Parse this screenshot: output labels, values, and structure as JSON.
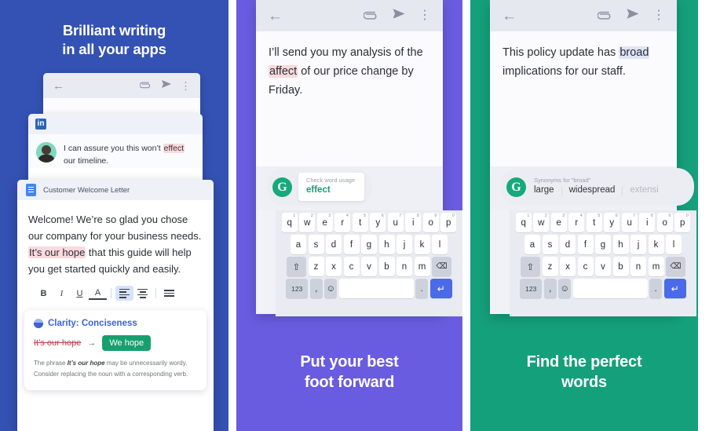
{
  "panels": [
    {
      "id": "panel-brilliant-writing",
      "bg": "#3452b4",
      "headline": "Brilliant writing\nin all your apps",
      "headline_line1": "Brilliant writing",
      "headline_line2": "in all your apps",
      "email_card": {
        "icons": [
          "back-arrow-icon",
          "attachment-icon",
          "send-icon",
          "overflow-menu-icon"
        ]
      },
      "linkedin_card": {
        "logo_text": "in",
        "message_line1_pre": "I can assure you this won’t",
        "message_highlight": "effect",
        "message_line2_post": " our timeline."
      },
      "doc_card": {
        "title": "Customer Welcome Letter",
        "paragraph_pre": "Welcome! We’re so glad you chose our company for your business needs. ",
        "paragraph_highlight": "It’s our hope",
        "paragraph_post": " that this guide will help you get started quickly and easily.",
        "toolbar": [
          "B",
          "I",
          "U",
          "A"
        ],
        "clarity_card": {
          "title": "Clarity: Conciseness",
          "old_text": "It’s our hope",
          "arrow": "→",
          "new_text": "We hope",
          "desc_pre": "The phrase ",
          "desc_bold": "It’s our hope",
          "desc_post": " may be unnecessarily wordy. Consider replacing the noun with a corresponding verb."
        }
      }
    },
    {
      "id": "panel-put-your-best-foot-forward",
      "bg": "#6a5ce0",
      "caption_line1": "Put your best",
      "caption_line2": "foot forward",
      "message_pre": "I’ll send you my analysis of the ",
      "message_highlight": "affect",
      "message_post": " of our price change by Friday.",
      "chip": {
        "logo": "G",
        "label": "Check word usage",
        "value": "effect"
      }
    },
    {
      "id": "panel-find-the-perfect-words",
      "bg": "#14a07a",
      "caption_line1": "Find the perfect",
      "caption_line2": "words",
      "message_pre": "This policy update has ",
      "message_highlight": "broad",
      "message_post": " implications for our staff.",
      "chip": {
        "logo": "G",
        "label": "Synonyms for “broad”",
        "synonyms": [
          "large",
          "widespread",
          "extensi"
        ]
      }
    }
  ],
  "keyboard": {
    "row1": [
      {
        "k": "q",
        "n": "1"
      },
      {
        "k": "w",
        "n": "2"
      },
      {
        "k": "e",
        "n": "3"
      },
      {
        "k": "r",
        "n": "4"
      },
      {
        "k": "t",
        "n": "5"
      },
      {
        "k": "y",
        "n": "6"
      },
      {
        "k": "u",
        "n": "7"
      },
      {
        "k": "i",
        "n": "8"
      },
      {
        "k": "o",
        "n": "9"
      },
      {
        "k": "p",
        "n": "0"
      }
    ],
    "row2": [
      "a",
      "s",
      "d",
      "f",
      "g",
      "h",
      "j",
      "k",
      "l"
    ],
    "row3_shift": "⇧",
    "row3": [
      "z",
      "x",
      "c",
      "v",
      "b",
      "n",
      "m"
    ],
    "row3_backspace": "⌫",
    "row4": {
      "num": "123",
      "comma": ",",
      "emoji": "☺",
      "space": "",
      "period": ".",
      "enter": "↵"
    }
  },
  "colors": {
    "panel1_bg": "#3452b4",
    "panel2_bg": "#6a5ce0",
    "panel3_bg": "#14a07a",
    "highlight_red": "#fbd9dd",
    "highlight_blue": "#dfe4f4",
    "accent_green": "#17a06f",
    "accent_blue": "#3c63d8",
    "enter_key": "#4a6ae8"
  }
}
